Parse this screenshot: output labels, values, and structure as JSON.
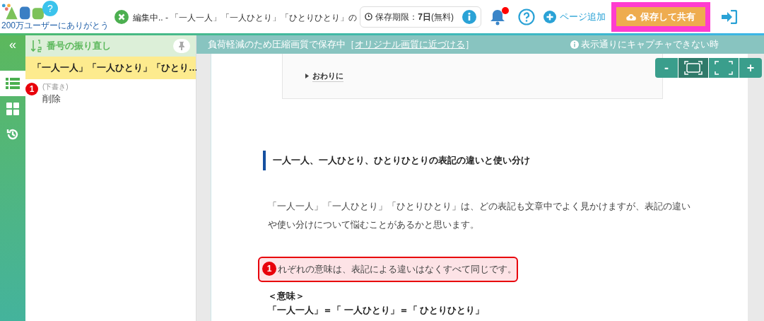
{
  "header": {
    "logo_badge": "?",
    "logo_tagline": "200万ユーザーにありがとう",
    "doc_title": "編集中.. - 「一人一人」「一人ひとり」「ひとりひとり」の",
    "expiry_label": "保存期限：",
    "expiry_value": "7日",
    "expiry_note": "(無料)",
    "notification_unread": true,
    "add_page": "ページ追加",
    "save_share": "保存して共有"
  },
  "rail": {
    "collapse": "«",
    "items": [
      {
        "kind": "list",
        "selected": true
      },
      {
        "kind": "grid",
        "selected": false
      },
      {
        "kind": "history",
        "selected": false
      }
    ]
  },
  "sidebar": {
    "title": "番号の振り直し",
    "items": [
      {
        "title": "「一人一人」「一人ひとり」「ひとり…",
        "selected": true
      }
    ],
    "notes": [
      {
        "number": "1",
        "status": "(下書き)",
        "text": "削除"
      }
    ]
  },
  "banner": {
    "message": "負荷軽減のため圧縮画質で保存中［",
    "link": "オリジナル画質に近づける",
    "close": "］",
    "help": "表示通りにキャプチャできない時"
  },
  "zoom_controls": [
    {
      "kind": "text",
      "label": "-"
    },
    {
      "kind": "fit",
      "selected": true
    },
    {
      "kind": "full",
      "selected": false
    },
    {
      "kind": "text",
      "label": "+"
    }
  ],
  "document": {
    "toc_item": "おわりに",
    "heading": "一人一人、一人ひとり、ひとりひとりの表記の違いと使い分け",
    "paragraph": "「一人一人」「一人ひとり」「ひとりひとり」は、どの表記も文章中でよく見かけますが、表記の違いや使い分けについて悩むことがあるかと思います。",
    "annotation": {
      "number": "1",
      "text": "れぞれの意味は、表記による違いはなくすべて同じです。"
    },
    "subheading": "＜意味＞",
    "equation": "「一人一人」＝「 一人ひとり」＝「 ひとりひとり」"
  }
}
